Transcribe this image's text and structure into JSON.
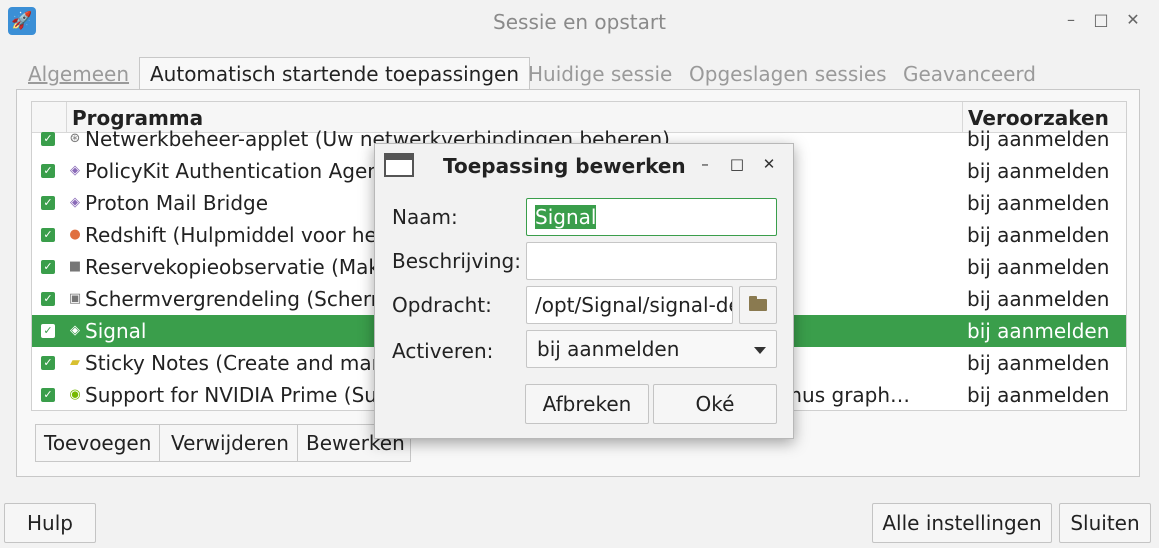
{
  "window": {
    "title": "Sessie en opstart",
    "app_icon": "rocket-icon"
  },
  "tabs": [
    {
      "label": "Algemeen",
      "active": false
    },
    {
      "label": "Automatisch startende toepassingen",
      "active": true
    },
    {
      "label": "Huidige sessie",
      "active": false
    },
    {
      "label": "Opgeslagen sessies",
      "active": false
    },
    {
      "label": "Geavanceerd",
      "active": false
    }
  ],
  "list": {
    "columns": {
      "program": "Programma",
      "trigger": "Veroorzaken"
    },
    "rows": [
      {
        "name": "Netwerkbeheer-applet (Uw netwerkverbindingen beheren)",
        "trigger": "bij aanmelden",
        "checked": true,
        "selected": false,
        "icon": "network-icon"
      },
      {
        "name": "PolicyKit Authentication Agent",
        "trigger": "bij aanmelden",
        "checked": true,
        "selected": false,
        "icon": "diamond-icon"
      },
      {
        "name": "Proton Mail Bridge",
        "trigger": "bij aanmelden",
        "checked": true,
        "selected": false,
        "icon": "diamond-icon"
      },
      {
        "name": "Redshift (Hulpmiddel voor het aanpassen van de kleurtemperatuur)",
        "trigger": "bij aanmelden",
        "checked": true,
        "selected": false,
        "icon": "redshift-icon"
      },
      {
        "name": "Reservekopieobservatie (Maken van reservekopieën plannen)",
        "trigger": "bij aanmelden",
        "checked": true,
        "selected": false,
        "icon": "backup-icon"
      },
      {
        "name": "Schermvergrendeling (Schermvergrendelaar)",
        "trigger": "bij aanmelden",
        "checked": true,
        "selected": false,
        "icon": "monitor-icon"
      },
      {
        "name": "Signal",
        "trigger": "bij aanmelden",
        "checked": true,
        "selected": true,
        "icon": "diamond-icon"
      },
      {
        "name": "Sticky Notes (Create and manage notes)",
        "trigger": "bij aanmelden",
        "checked": true,
        "selected": false,
        "icon": "sticky-note-icon"
      },
      {
        "name": "Support for NVIDIA Prime (Support for switching between NVIDIA Optimus graph…",
        "trigger": "bij aanmelden",
        "checked": true,
        "selected": false,
        "icon": "nvidia-icon"
      }
    ]
  },
  "toolbar": {
    "add": "Toevoegen",
    "remove": "Verwijderen",
    "edit": "Bewerken"
  },
  "footer": {
    "help": "Hulp",
    "all_settings": "Alle instellingen",
    "close": "Sluiten"
  },
  "dialog": {
    "title": "Toepassing bewerken",
    "name_label": "Naam:",
    "name_value": "Signal",
    "description_label": "Beschrijving:",
    "description_value": "",
    "command_label": "Opdracht:",
    "command_value": "/opt/Signal/signal-desktop",
    "trigger_label": "Activeren:",
    "trigger_value": "bij aanmelden",
    "cancel": "Afbreken",
    "ok": "Oké"
  },
  "colors": {
    "accent": "#3a9e4b",
    "background": "#f2f2f2",
    "nvidia": "#76b900"
  }
}
